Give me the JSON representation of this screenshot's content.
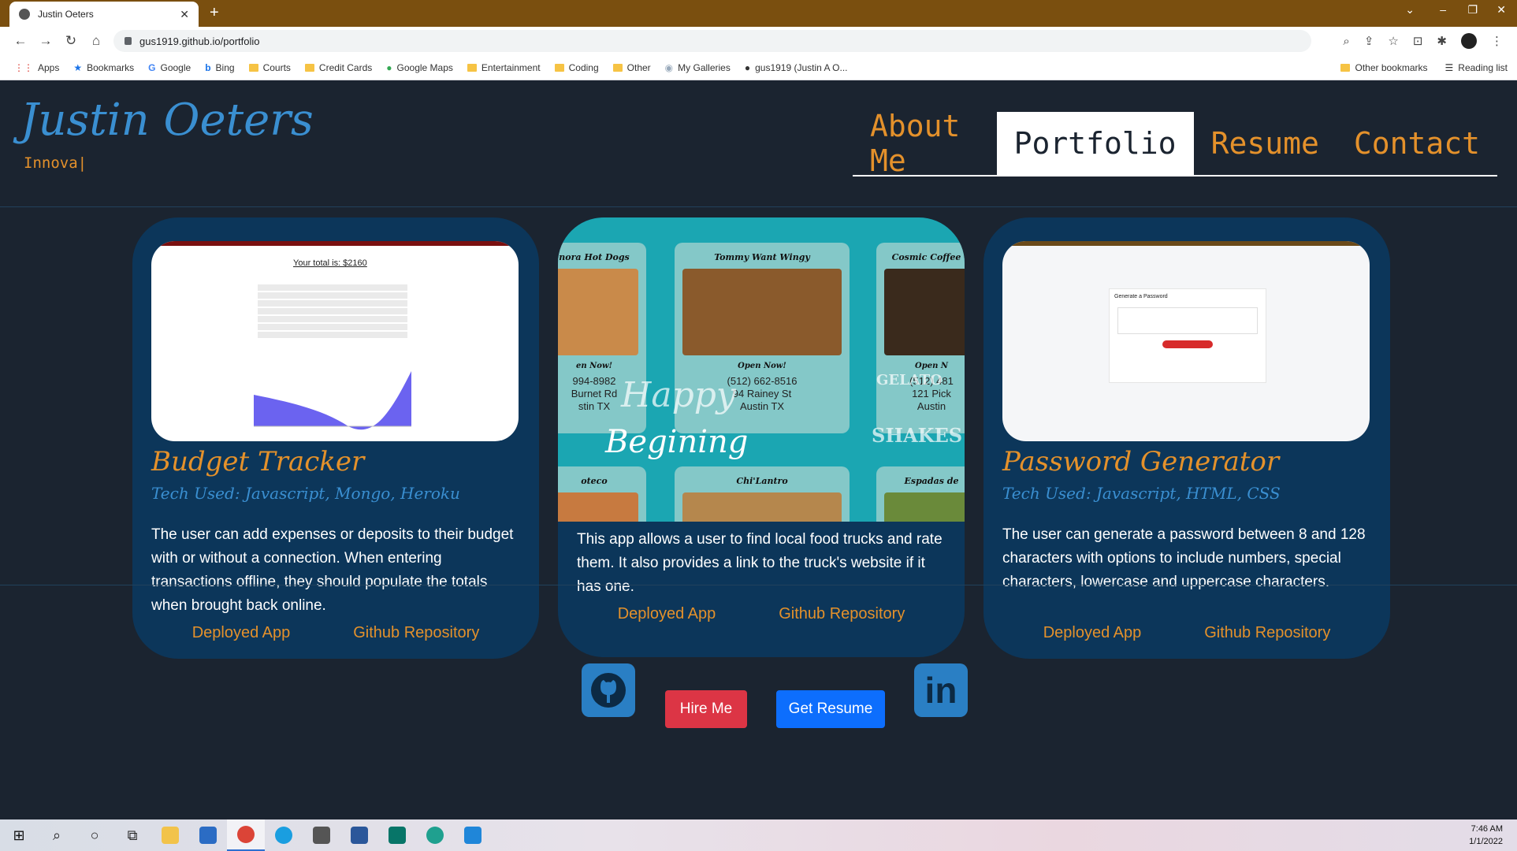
{
  "browser": {
    "tab_title": "Justin Oeters",
    "url": "gus1919.github.io/portfolio",
    "bookmarks": [
      "Apps",
      "Bookmarks",
      "Google",
      "Bing",
      "Courts",
      "Credit Cards",
      "Google Maps",
      "Entertainment",
      "Coding",
      "Other",
      "My Galleries",
      "gus1919 (Justin A O..."
    ],
    "bookmarks_right": [
      "Other bookmarks",
      "Reading list"
    ]
  },
  "header": {
    "brand": "Justin Oeters",
    "typing_text": "Innova|",
    "nav": [
      "About Me",
      "Portfolio",
      "Resume",
      "Contact"
    ],
    "active_nav": "Portfolio"
  },
  "projects": [
    {
      "title": "Budget Tracker",
      "tech": "Tech Used: Javascript, Mongo, Heroku",
      "description": "The user can add expenses or deposits to their budget with or without a connection. When entering transactions offline, they should populate the totals when brought back online.",
      "thumb_total": "Your total is: $2160",
      "deployed_label": "Deployed App",
      "repo_label": "Github Repository"
    },
    {
      "title": "",
      "tech": "",
      "description": "This app allows a user to find local food trucks and rate them. It also provides a link to the truck's website if it has one.",
      "image_tiles": [
        {
          "name": "nora Hot Dogs",
          "open": "en Now!",
          "phone": "994-8982",
          "street": "Burnet Rd",
          "city": "stin TX"
        },
        {
          "name": "Tommy Want Wingy",
          "open": "Open Now!",
          "phone": "(512) 662-8516",
          "street": "94 Rainey St",
          "city": "Austin TX"
        },
        {
          "name": "Cosmic Coffee +",
          "open": "Open N",
          "phone": "(512) 481",
          "street": "121 Pick",
          "city": "Austin"
        }
      ],
      "image_bottom_labels": [
        "oteco",
        "Chi'Lantro",
        "Espadas de"
      ],
      "image_script_words": [
        "Happy",
        "Begining",
        "SHAKES",
        "GELATO"
      ],
      "deployed_label": "Deployed App",
      "repo_label": "Github Repository"
    },
    {
      "title": "Password Generator",
      "tech": "Tech Used: Javascript, HTML, CSS",
      "description": "The user can generate a password between 8 and 128 characters with options to include numbers, special characters, lowercase and uppercase characters.",
      "thumb_heading": "Generate a Password",
      "deployed_label": "Deployed App",
      "repo_label": "Github Repository"
    }
  ],
  "footer": {
    "hire_label": "Hire Me",
    "resume_label": "Get Resume",
    "github_icon": "github-icon",
    "linkedin_icon": "linkedin-icon",
    "linkedin_text": "in"
  },
  "taskbar": {
    "time": "7:46 AM",
    "date": "1/1/2022"
  },
  "colors": {
    "accent_orange": "#e4912b",
    "accent_blue": "#3a8fd1",
    "card_bg": "#0c365a",
    "page_bg": "#1b2430"
  }
}
